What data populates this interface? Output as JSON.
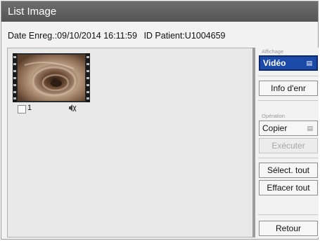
{
  "window": {
    "title": "List Image"
  },
  "info": {
    "date": "Date Enreg.:09/10/2014 16:11:59",
    "patient": "ID Patient:U1004659"
  },
  "thumbnails": [
    {
      "number": "1",
      "warning_icon": "mute-speaker-icon"
    }
  ],
  "sidebar": {
    "affichage_label": "Affichage",
    "video_label": "Vidéo",
    "info_label": "Info d'enr",
    "operation_label": "Opération",
    "copier_label": "Copier",
    "executer_label": "Exécuter",
    "select_all_label": "Sélect. tout",
    "clear_all_label": "Effacer tout",
    "back_label": "Retour"
  },
  "colors": {
    "selected": "#1c4aa8",
    "titlebar": "#5f5f5f"
  }
}
